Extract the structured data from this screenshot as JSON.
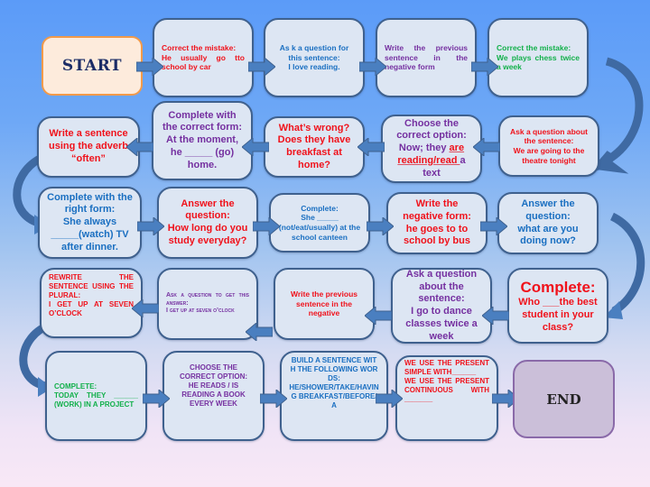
{
  "board": {
    "start_label": "START",
    "end_label": "END",
    "row1": [
      {
        "title": "Correct the mistake:",
        "body": "He usually go tto school by car"
      },
      {
        "title": "As k a question for this sentence:",
        "body": "I love reading."
      },
      {
        "title": "Write the previous sentence in the negative form",
        "body": ""
      },
      {
        "title": "Correct the mistake:",
        "body": "We plays chess twice a week"
      }
    ],
    "row2": [
      {
        "title": "Write a sentence using the adverb",
        "body": "“often”"
      },
      {
        "title": "Complete with the correct form:",
        "body": "At the moment, he _____ (go) home."
      },
      {
        "title": "What’s wrong?",
        "body": "Does they have breakfast at home?"
      },
      {
        "title": "Choose the correct option:",
        "body_pre": "Now; they ",
        "body_underlined": "are reading/read ",
        "body_post": "a text"
      },
      {
        "title": "Ask a question about the sentence:",
        "body": "We are going to the theatre tonight"
      }
    ],
    "row3": [
      {
        "title": "Complete with the right form:",
        "body": "She always _____(watch) TV after dinner."
      },
      {
        "title": "Answer the question:",
        "body": "How long do you study everyday?"
      },
      {
        "title": "Complete:",
        "body": "She _____ (not/eat/usually) at the school canteen"
      },
      {
        "title": "Write the negative form:",
        "body": "he goes to to school by bus"
      },
      {
        "title": "Answer the question:",
        "body": "what are you doing now?"
      }
    ],
    "row4": [
      {
        "title": "REWRITE THE SENTENCE USING THE PLURAL:",
        "body": "I GET UP AT SEVEN O’CLOCK"
      },
      {
        "title": "Ask a question to get this answer:",
        "body": "I get up at seven o’clock"
      },
      {
        "title": "Write the previous sentence in the negative",
        "body": ""
      },
      {
        "title": "Ask a question about the sentence:",
        "body": "I go to dance classes twice a week"
      },
      {
        "title": "Complete:",
        "body": "Who ___the best student in your class?"
      }
    ],
    "row5": [
      {
        "title": "COMPLETE:",
        "body": "TODAY THEY ______ (WORK) IN A PROJECT"
      },
      {
        "title": "CHOOSE THE CORRECT OPTION:",
        "body": "HE READS / IS READING A BOOK EVERY WEEK"
      },
      {
        "title": "BUILD A SENTENCE WITH THE FOLLOWING WORDS:",
        "body": "HE/SHOWER/TAKE/HAVING BREAKFAST/BEFORE/A"
      },
      {
        "line1": "WE USE THE PRESENT SIMPLE WITH______",
        "line2": "WE USE THE PRESENT CONTINUOUS WITH _______"
      }
    ]
  },
  "colors": {
    "red": "#f0121b",
    "blue": "#1a6fc1",
    "purple": "#7530a0",
    "green": "#12b04a",
    "card_fill": "#dde6f3",
    "card_border": "#3f618e",
    "arrow": "#4a7fc0",
    "start_fill": "#fdebdc",
    "end_fill": "#cbbfd9"
  }
}
